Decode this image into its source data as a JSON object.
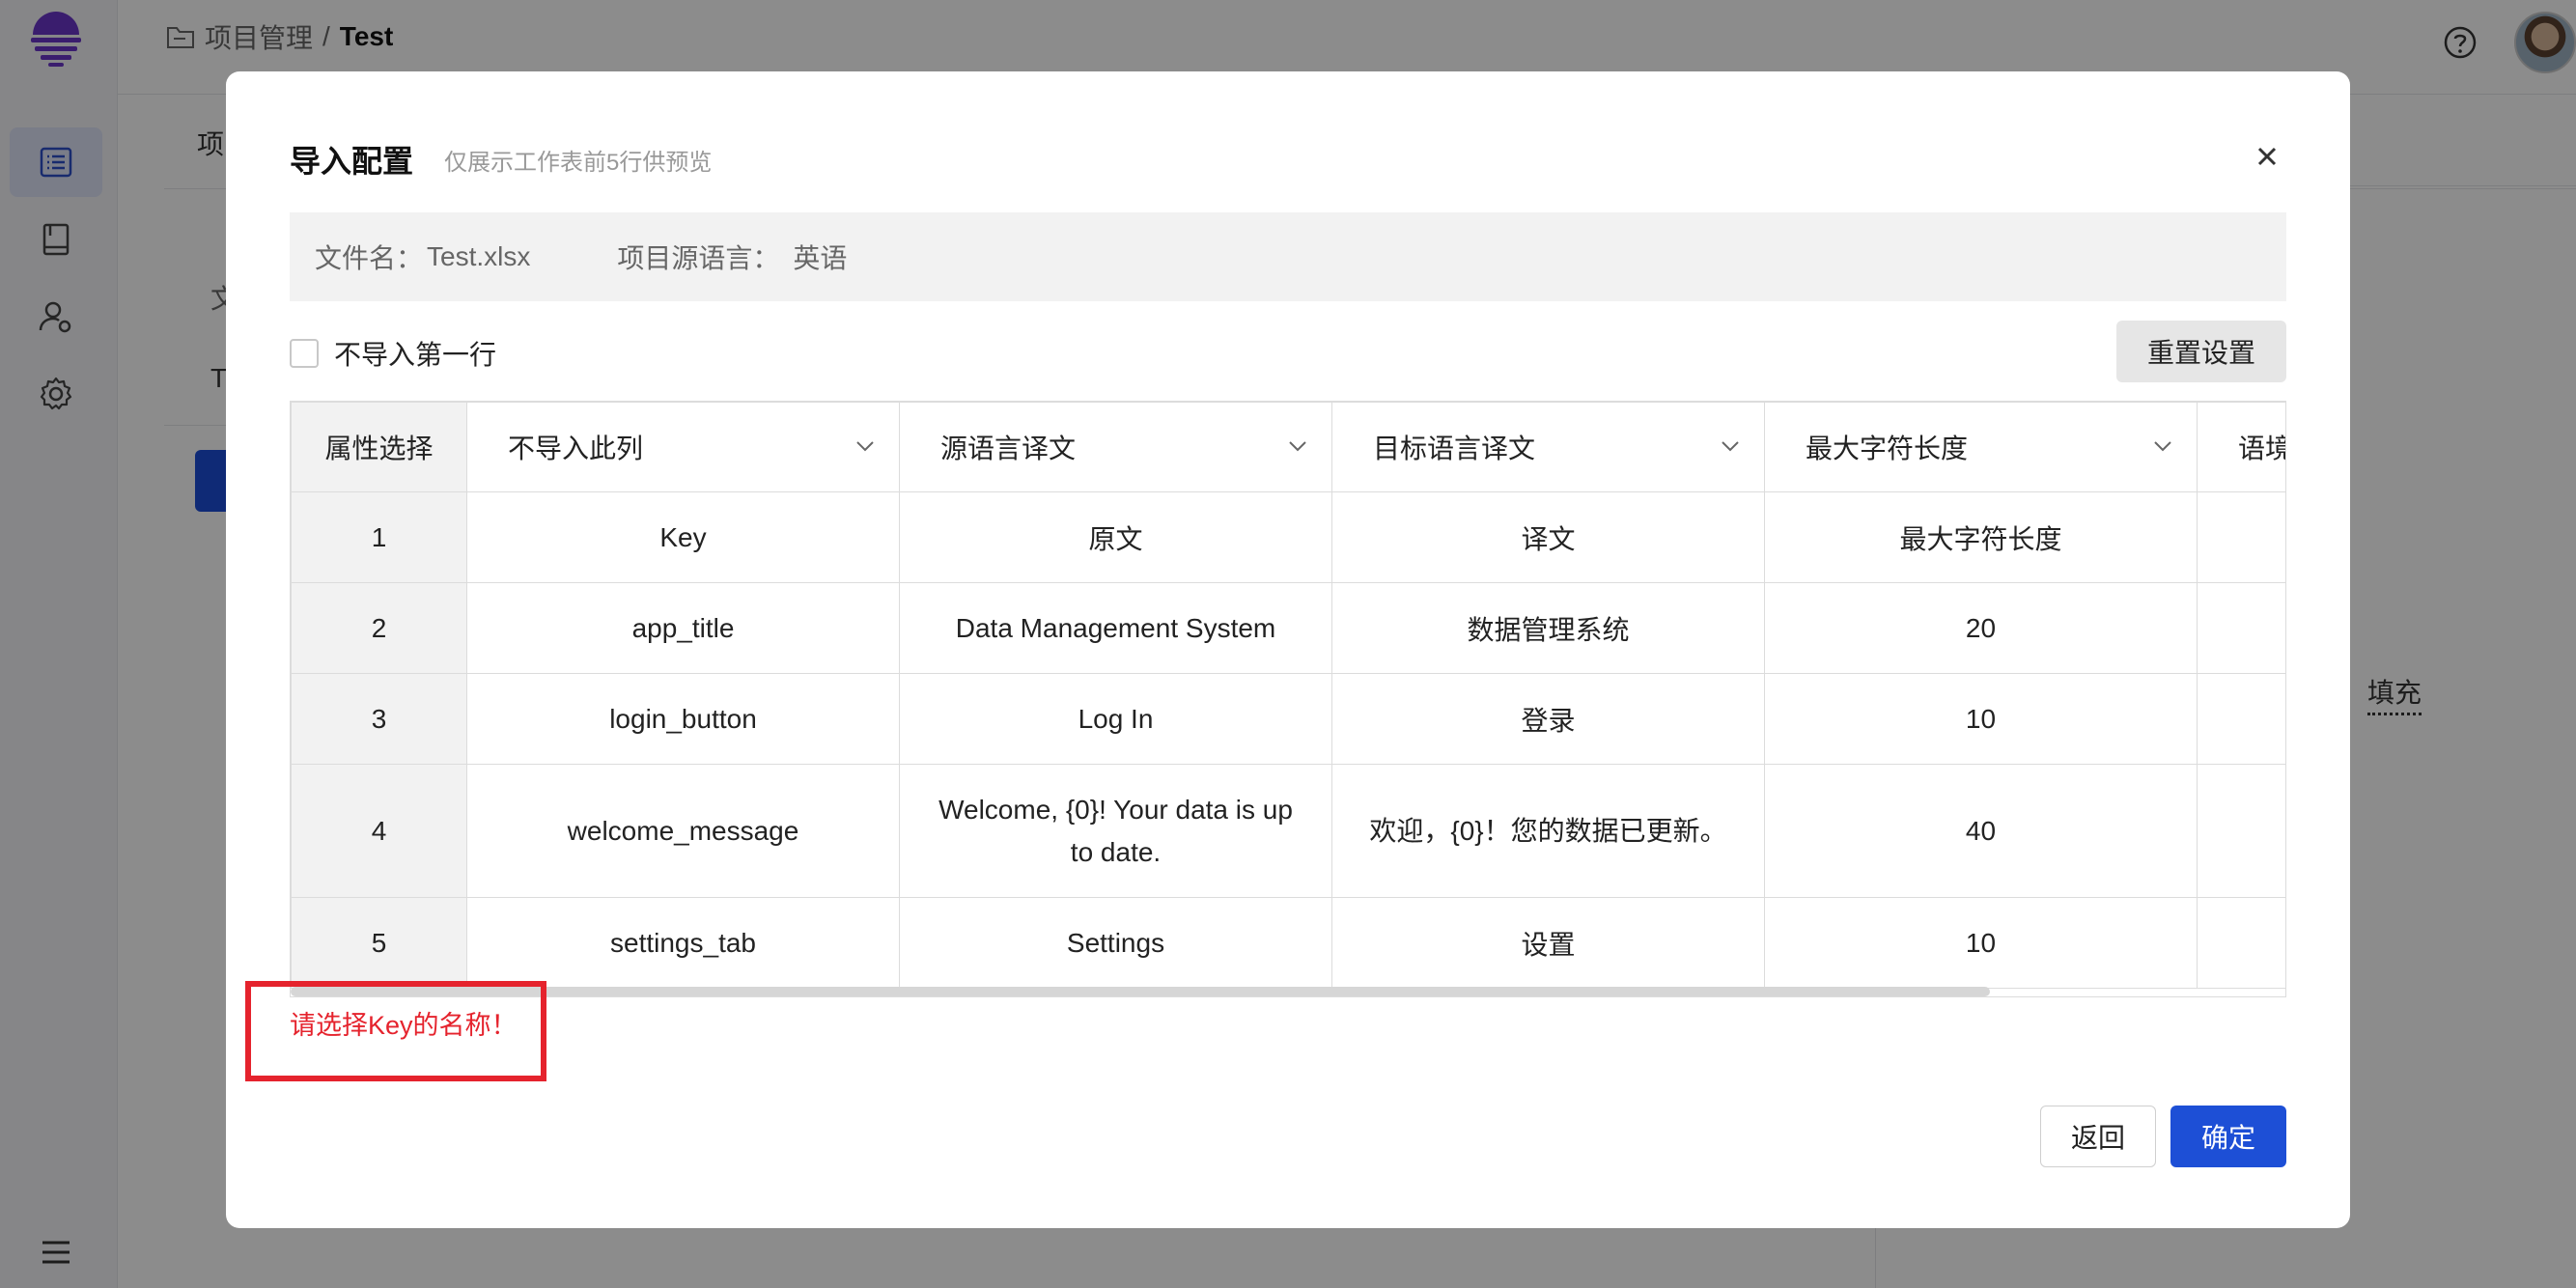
{
  "breadcrumb": {
    "parent": "项目管理",
    "separator": "/",
    "current": "Test"
  },
  "background": {
    "tab": "项",
    "col": "文",
    "row": "T",
    "fill_label": "填充"
  },
  "sidebar": {
    "items": [
      "list-icon",
      "book-icon",
      "user-settings-icon",
      "gear-icon"
    ],
    "active_index": 0
  },
  "modal": {
    "title": "导入配置",
    "subtitle": "仅展示工作表前5行供预览",
    "file_label": "文件名：",
    "file_name": "Test.xlsx",
    "lang_label": "项目源语言：",
    "lang_value": "英语",
    "skip_first_row": "不导入第一行",
    "reset_button": "重置设置",
    "table": {
      "header_first": "属性选择",
      "column_selects": [
        "不导入此列",
        "源语言译文",
        "目标语言译文",
        "最大字符长度",
        "语境"
      ],
      "rows": [
        {
          "index": "1",
          "cells": [
            "Key",
            "原文",
            "译文",
            "最大字符长度"
          ]
        },
        {
          "index": "2",
          "cells": [
            "app_title",
            "Data Management System",
            "数据管理系统",
            "20"
          ]
        },
        {
          "index": "3",
          "cells": [
            "login_button",
            "Log In",
            "登录",
            "10"
          ]
        },
        {
          "index": "4",
          "cells": [
            "welcome_message",
            "Welcome, {0}! Your data is up to date.",
            "欢迎，{0}！您的数据已更新。",
            "40"
          ]
        },
        {
          "index": "5",
          "cells": [
            "settings_tab",
            "Settings",
            "设置",
            "10"
          ]
        }
      ]
    },
    "error_message": "请选择Key的名称！",
    "back_button": "返回",
    "confirm_button": "确定"
  },
  "colors": {
    "primary": "#1d4fd6",
    "error": "#e5232d",
    "header_bg": "#f2f2f2"
  }
}
